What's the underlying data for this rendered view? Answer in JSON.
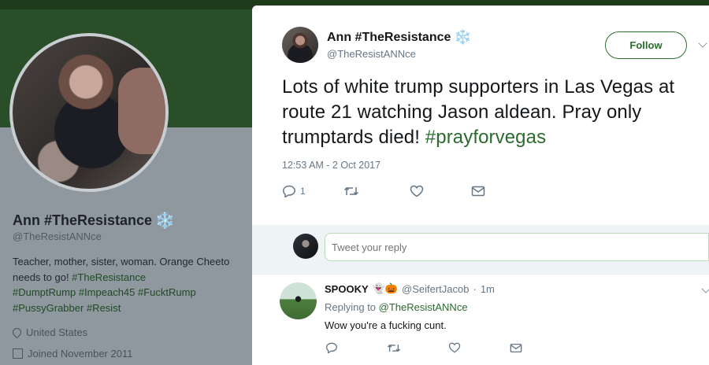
{
  "profile": {
    "name": "Ann #TheResistance",
    "name_emoji": "❄️",
    "handle": "@TheResistANNce",
    "bio_text": "Teacher, mother, sister, woman. Orange Cheeto needs to go! ",
    "bio_tags": [
      "#TheResistance",
      "#DumptRump",
      "#Impeach45",
      "#FucktRump",
      "#PussyGrabber",
      "#Resist"
    ],
    "location": "United States",
    "joined": "Joined November 2011"
  },
  "tweet": {
    "author_name": "Ann #TheResistance",
    "author_emoji": "❄️",
    "author_handle": "@TheResistANNce",
    "follow_label": "Follow",
    "text": "Lots of white trump supporters in Las Vegas at route 21 watching Jason aldean. Pray only trumptards died! ",
    "hashtag": "#prayforvegas",
    "timestamp": "12:53 AM - 2 Oct 2017",
    "reply_count": "1",
    "icons": [
      "reply-icon",
      "retweet-icon",
      "like-icon",
      "message-icon"
    ]
  },
  "reply_box": {
    "placeholder": "Tweet your reply"
  },
  "reply": {
    "name": "SPOOKY",
    "emojis": "👻🎃",
    "handle": "@SeifertJacob",
    "sep": "·",
    "time": "1m",
    "replying_prefix": "Replying to ",
    "replying_to": "@TheResistANNce",
    "text": "Wow you're a fucking cunt."
  },
  "colors": {
    "accent": "#2b6b2e",
    "banner": "#2a4e27",
    "overlay_gray": "#8f989f"
  }
}
